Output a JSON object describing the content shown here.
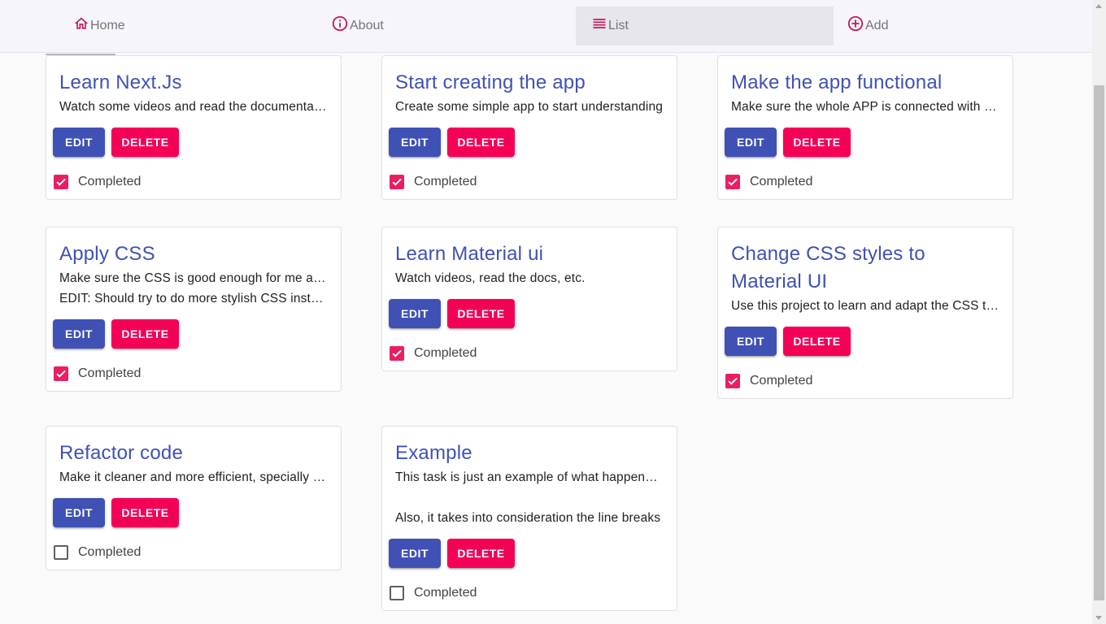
{
  "nav": {
    "items": [
      {
        "label": "Home",
        "icon": "home-icon"
      },
      {
        "label": "About",
        "icon": "info-icon"
      },
      {
        "label": "List",
        "icon": "list-icon",
        "active": true
      },
      {
        "label": "Add",
        "icon": "add-circle-icon"
      }
    ]
  },
  "colors": {
    "primary": "#3f51b5",
    "secondary": "#f50057",
    "checkbox": "#e91e63"
  },
  "cards": [
    {
      "title": "Learn Next.Js",
      "desc": [
        "Watch some videos and read the documentation"
      ],
      "edit_label": "EDIT",
      "delete_label": "DELETE",
      "completed_label": "Completed",
      "completed": true
    },
    {
      "title": "Start creating the app",
      "desc": [
        "Create some simple app to start understanding"
      ],
      "edit_label": "EDIT",
      "delete_label": "DELETE",
      "completed_label": "Completed",
      "completed": true
    },
    {
      "title": "Make the app functional",
      "desc": [
        "Make sure the whole APP is connected with the API"
      ],
      "edit_label": "EDIT",
      "delete_label": "DELETE",
      "completed_label": "Completed",
      "completed": true
    },
    {
      "title": "Apply CSS",
      "desc": [
        "Make sure the CSS is good enough for me and others",
        "EDIT: Should try to do more stylish CSS instead"
      ],
      "edit_label": "EDIT",
      "delete_label": "DELETE",
      "completed_label": "Completed",
      "completed": true
    },
    {
      "title": "Learn Material ui",
      "desc": [
        "Watch videos, read the docs, etc."
      ],
      "edit_label": "EDIT",
      "delete_label": "DELETE",
      "completed_label": "Completed",
      "completed": true
    },
    {
      "title": "Change CSS styles to Material UI",
      "desc": [
        "Use this project to learn and adapt the CSS to Material UI"
      ],
      "edit_label": "EDIT",
      "delete_label": "DELETE",
      "completed_label": "Completed",
      "completed": true
    },
    {
      "title": "Refactor code",
      "desc": [
        "Make it cleaner and more efficient, specially the components"
      ],
      "edit_label": "EDIT",
      "delete_label": "DELETE",
      "completed_label": "Completed",
      "completed": false
    },
    {
      "title": "Example",
      "desc": [
        "This task is just an example of what happens with long text",
        "",
        "Also, it takes into consideration the line breaks"
      ],
      "edit_label": "EDIT",
      "delete_label": "DELETE",
      "completed_label": "Completed",
      "completed": false
    }
  ]
}
